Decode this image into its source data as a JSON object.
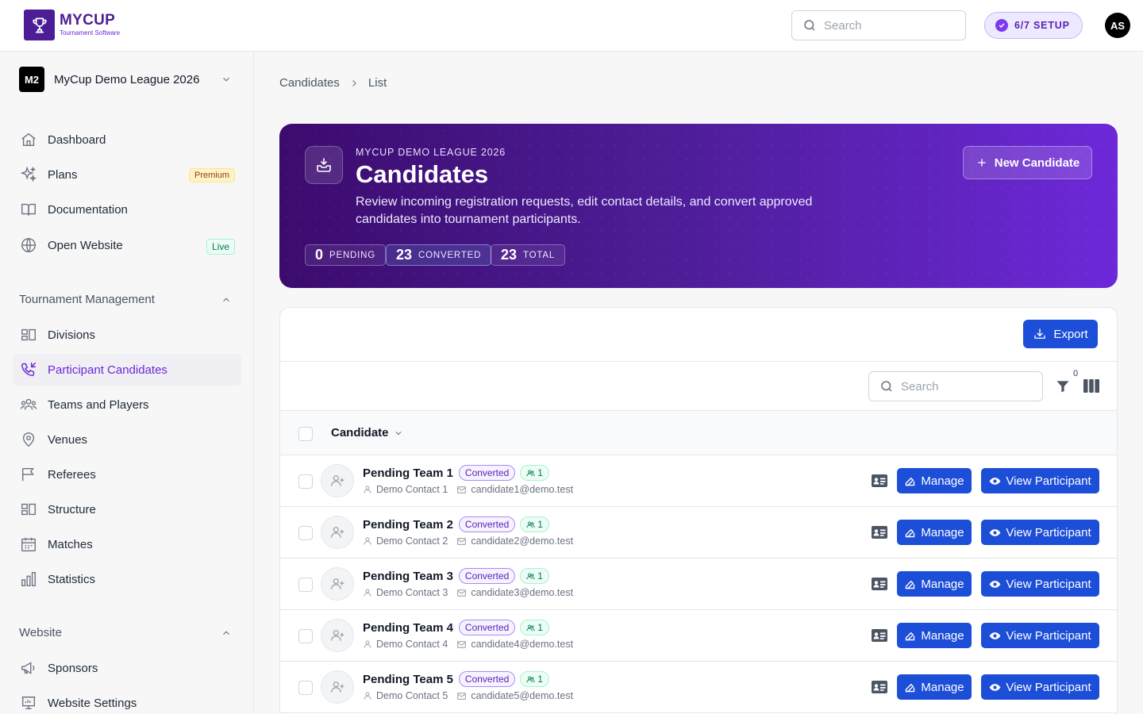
{
  "app": {
    "logo_name": "MYCUP",
    "logo_sub": "Tournament Software",
    "search_placeholder": "Search",
    "setup_label": "6/7 SETUP",
    "user_initials": "AS"
  },
  "sidebar": {
    "league_badge": "M2",
    "league_name": "MyCup Demo League 2026",
    "top_items": [
      {
        "label": "Dashboard",
        "icon": "home-icon"
      },
      {
        "label": "Plans",
        "icon": "sparkles-icon",
        "badge": "Premium"
      },
      {
        "label": "Documentation",
        "icon": "book-icon"
      },
      {
        "label": "Open Website",
        "icon": "globe-icon",
        "badge": "Live"
      }
    ],
    "section_tournament": "Tournament Management",
    "tournament_items": [
      {
        "label": "Divisions",
        "icon": "divisions-icon"
      },
      {
        "label": "Participant Candidates",
        "icon": "phone-incoming-icon",
        "active": true
      },
      {
        "label": "Teams and Players",
        "icon": "users-icon"
      },
      {
        "label": "Venues",
        "icon": "map-pin-icon"
      },
      {
        "label": "Referees",
        "icon": "flag-icon"
      },
      {
        "label": "Structure",
        "icon": "structure-icon"
      },
      {
        "label": "Matches",
        "icon": "calendar-icon"
      },
      {
        "label": "Statistics",
        "icon": "bar-chart-icon"
      }
    ],
    "section_website": "Website",
    "website_items": [
      {
        "label": "Sponsors",
        "icon": "megaphone-icon"
      },
      {
        "label": "Website Settings",
        "icon": "presentation-icon"
      }
    ]
  },
  "breadcrumb": [
    "Candidates",
    "List"
  ],
  "hero": {
    "kicker": "MYCUP DEMO LEAGUE 2026",
    "title": "Candidates",
    "description": "Review incoming registration requests, edit contact details, and convert approved candidates into tournament participants.",
    "new_button": "New Candidate",
    "stats": [
      {
        "value": "0",
        "label": "PENDING"
      },
      {
        "value": "23",
        "label": "CONVERTED"
      },
      {
        "value": "23",
        "label": "TOTAL"
      }
    ]
  },
  "table": {
    "export_label": "Export",
    "search_placeholder": "Search",
    "filter_count": "0",
    "column_header": "Candidate",
    "manage_label": "Manage",
    "view_label": "View Participant",
    "rows": [
      {
        "name": "Pending Team 1",
        "status": "Converted",
        "count": "1",
        "contact": "Demo Contact 1",
        "email": "candidate1@demo.test"
      },
      {
        "name": "Pending Team 2",
        "status": "Converted",
        "count": "1",
        "contact": "Demo Contact 2",
        "email": "candidate2@demo.test"
      },
      {
        "name": "Pending Team 3",
        "status": "Converted",
        "count": "1",
        "contact": "Demo Contact 3",
        "email": "candidate3@demo.test"
      },
      {
        "name": "Pending Team 4",
        "status": "Converted",
        "count": "1",
        "contact": "Demo Contact 4",
        "email": "candidate4@demo.test"
      },
      {
        "name": "Pending Team 5",
        "status": "Converted",
        "count": "1",
        "contact": "Demo Contact 5",
        "email": "candidate5@demo.test"
      }
    ]
  },
  "colors": {
    "brand": "#4c1d95",
    "accent": "#6d28d9",
    "primary_button": "#1d4ed8"
  }
}
